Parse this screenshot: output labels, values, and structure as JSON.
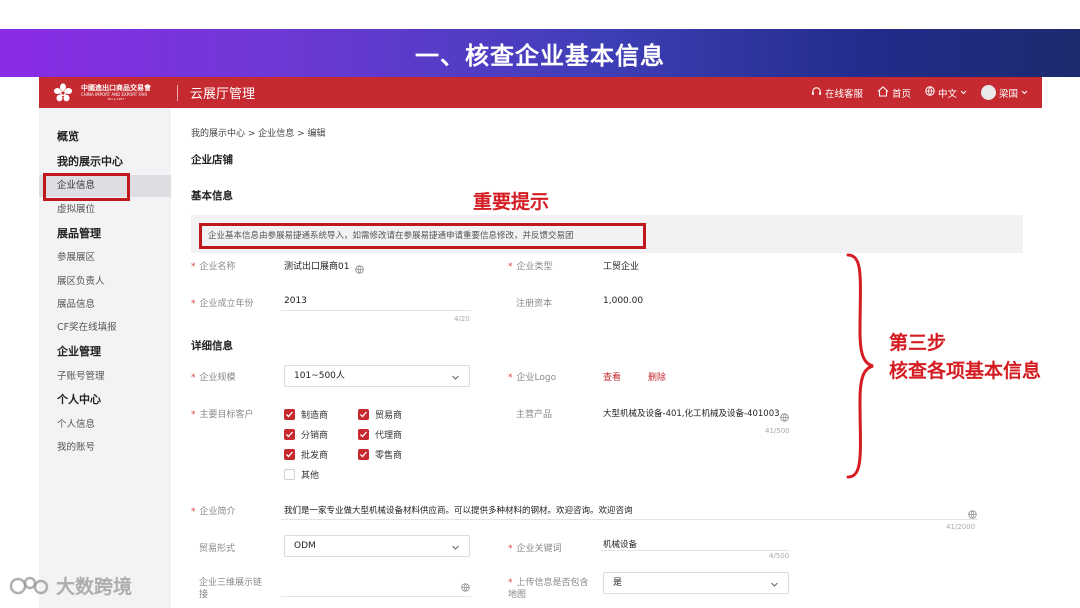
{
  "slide": {
    "title": "一、核查企业基本信息"
  },
  "header": {
    "logo": {
      "cn": "中國進出口商品交易會",
      "en": "CHINA IMPORT AND EXPORT FAIR",
      "since": "Since 1957"
    },
    "title": "云展厅管理",
    "online_service": "在线客服",
    "home": "首页",
    "language": "中文",
    "user": "梁国"
  },
  "sidebar": {
    "items": [
      {
        "label": "概览",
        "type": "group"
      },
      {
        "label": "我的展示中心",
        "type": "group"
      },
      {
        "label": "企业信息",
        "type": "item",
        "active": true
      },
      {
        "label": "虚拟展位",
        "type": "item"
      },
      {
        "label": "展品管理",
        "type": "group"
      },
      {
        "label": "参展展区",
        "type": "item"
      },
      {
        "label": "展区负责人",
        "type": "item"
      },
      {
        "label": "展品信息",
        "type": "item"
      },
      {
        "label": "CF奖在线填报",
        "type": "item"
      },
      {
        "label": "企业管理",
        "type": "group"
      },
      {
        "label": "子账号管理",
        "type": "item"
      },
      {
        "label": "个人中心",
        "type": "group"
      },
      {
        "label": "个人信息",
        "type": "item"
      },
      {
        "label": "我的账号",
        "type": "item"
      }
    ]
  },
  "main": {
    "breadcrumb": "我的展示中心 > 企业信息 > 编辑",
    "store_title": "企业店铺",
    "basic_title": "基本信息",
    "notice": "企业基本信息由参展易捷通系统导入，如需修改请在参展易捷通申请重要信息修改，并反馈交易团",
    "company_name": {
      "label": "企业名称",
      "value": "测试出口展商01"
    },
    "company_type": {
      "label": "企业类型",
      "value": "工贸企业"
    },
    "founded": {
      "label": "企业成立年份",
      "value": "2013",
      "count": "4/20"
    },
    "capital": {
      "label": "注册资本",
      "value": "1,000.00"
    },
    "detail_title": "详细信息",
    "scale": {
      "label": "企业规模",
      "value": "101~500人"
    },
    "logo_field": {
      "label": "企业Logo",
      "view": "查看",
      "delete": "删除"
    },
    "customers": {
      "label": "主要目标客户",
      "options": [
        {
          "label": "制造商",
          "checked": true
        },
        {
          "label": "贸易商",
          "checked": true
        },
        {
          "label": "分销商",
          "checked": true
        },
        {
          "label": "代理商",
          "checked": true
        },
        {
          "label": "批发商",
          "checked": true
        },
        {
          "label": "零售商",
          "checked": true
        },
        {
          "label": "其他",
          "checked": false
        }
      ]
    },
    "products": {
      "label": "主营产品",
      "value": "大型机械及设备-401,化工机械及设备-401003",
      "count": "41/500"
    },
    "intro": {
      "label": "企业简介",
      "value": "我们是一家专业做大型机械设备材料供应商。可以提供多种材料的钢材。欢迎咨询。欢迎咨询",
      "count": "41/2000"
    },
    "trade_form": {
      "label": "贸易形式",
      "value": "ODM"
    },
    "keywords": {
      "label": "企业关键词",
      "value": "机械设备",
      "count": "4/500"
    },
    "showroom_link": {
      "label": "企业三维展示链接"
    },
    "upload_map": {
      "label": "上传信息是否包含地图",
      "value": "是"
    }
  },
  "annotations": {
    "important": "重要提示",
    "step_line1": "第三步",
    "step_line2": "核查各项基本信息"
  },
  "watermark": {
    "text": "大数跨境"
  },
  "colors": {
    "brand_red": "#c42a2f",
    "callout_red": "#d41c22"
  }
}
